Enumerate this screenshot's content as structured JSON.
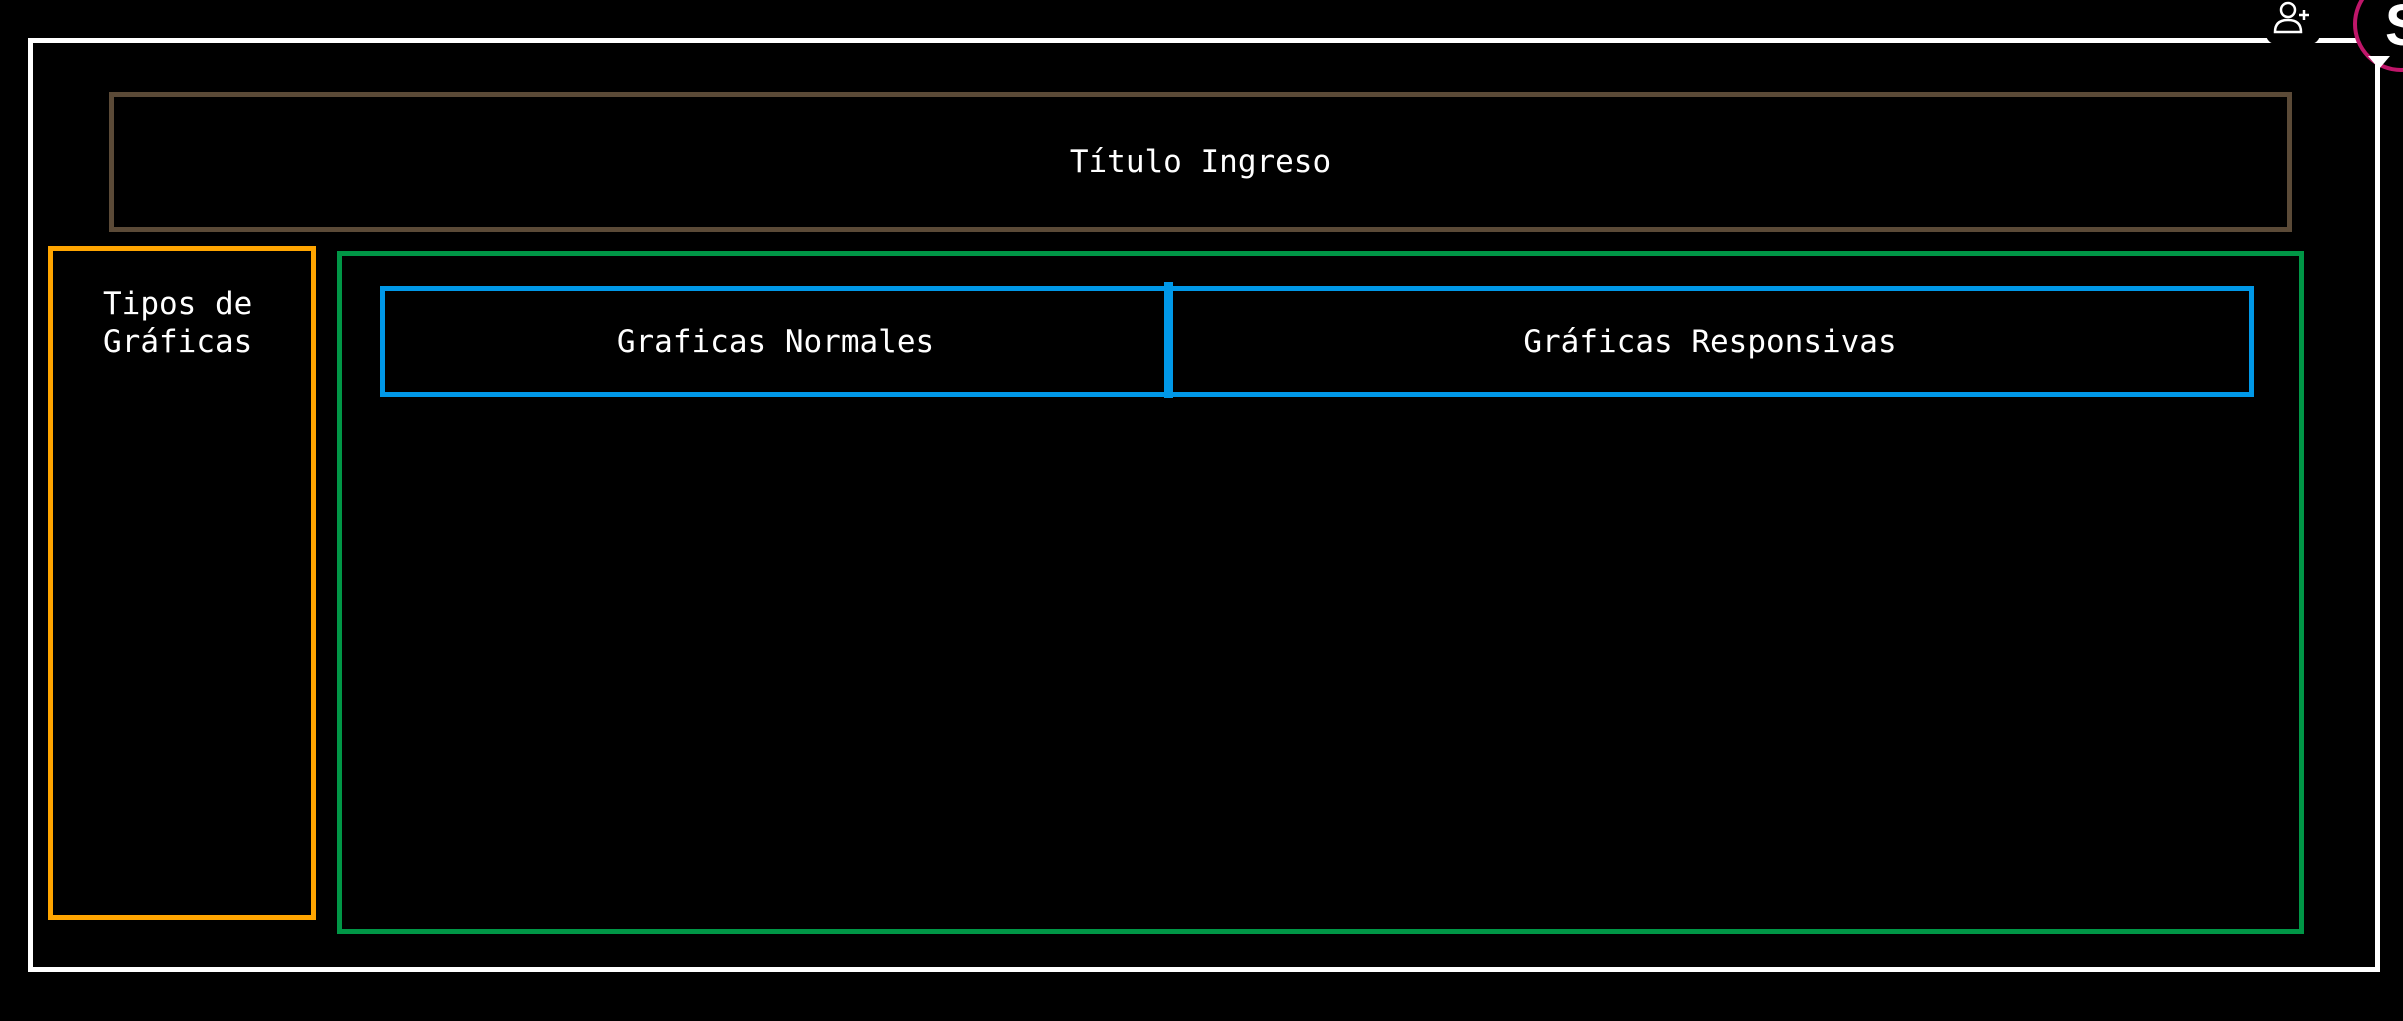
{
  "header": {
    "title": "Título Ingreso"
  },
  "sidebar": {
    "label": "Tipos de\nGráficas"
  },
  "tabs": [
    {
      "label": "Graficas Normales"
    },
    {
      "label": "Gráficas Responsivas"
    }
  ],
  "user": {
    "avatar_initial": "S",
    "add_user_icon": "add-user-icon",
    "caret_icon": "caret-down-icon"
  },
  "colors": {
    "background": "#000000",
    "outer_frame": "#ffffff",
    "title_border": "#5b4a37",
    "sidebar_border": "#ffa500",
    "main_border": "#009646",
    "tab_border": "#0098e8",
    "avatar_ring": "#c0166a"
  }
}
